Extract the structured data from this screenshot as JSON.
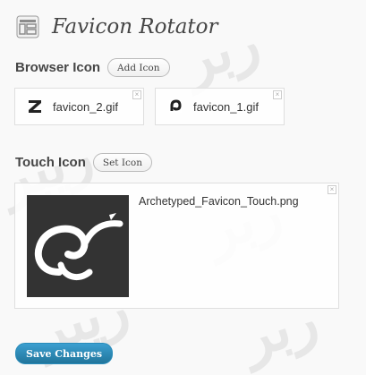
{
  "page": {
    "title": "Favicon Rotator",
    "icon": "settings-page-icon"
  },
  "browser_icon": {
    "heading": "Browser Icon",
    "add_button": "Add Icon",
    "items": [
      {
        "name": "favicon_2.gif",
        "icon": "favicon-2-glyph"
      },
      {
        "name": "favicon_1.gif",
        "icon": "favicon-1-glyph"
      }
    ]
  },
  "touch_icon": {
    "heading": "Touch Icon",
    "set_button": "Set Icon",
    "file_name": "Archetyped_Favicon_Touch.png",
    "thumb_color": "#333333"
  },
  "actions": {
    "save_label": "Save Changes"
  },
  "colors": {
    "accent": "#21759b",
    "title": "#464646"
  }
}
